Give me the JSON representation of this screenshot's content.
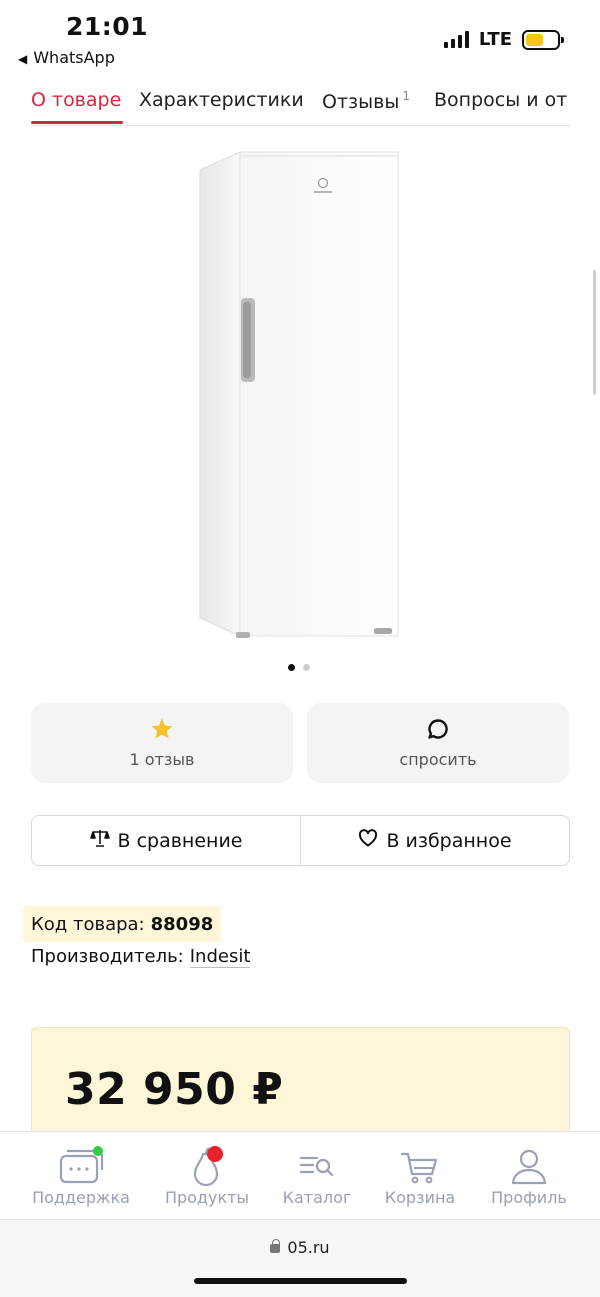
{
  "status_bar": {
    "time": "21:01",
    "back_app": "WhatsApp",
    "network": "LTE",
    "battery_level": 0.55,
    "battery_color": "#f5c518"
  },
  "tabs": [
    {
      "label": "О товаре",
      "active": true
    },
    {
      "label": "Характеристики",
      "active": false
    },
    {
      "label": "Отзывы",
      "count": "1",
      "active": false
    },
    {
      "label": "Вопросы и от",
      "active": false
    }
  ],
  "gallery": {
    "image_icon": "refrigerator-image",
    "brand_mark": "indesit",
    "page_index": 1,
    "page_count": 2
  },
  "cards": {
    "reviews_label": "1 отзыв",
    "reviews_icon": "star-icon",
    "ask_label": "спросить",
    "ask_icon": "chat-bubble-icon"
  },
  "actions": {
    "compare_label": "В сравнение",
    "favorite_label": "В избранное"
  },
  "info": {
    "code_label": "Код товара:",
    "code_value": "88098",
    "maker_label": "Производитель:",
    "maker_value": "Indesit"
  },
  "price": {
    "value": "32 950 ₽"
  },
  "bottom_nav": [
    {
      "label": "Поддержка",
      "icon": "chat-support-icon",
      "badge_color": "#2ecc40"
    },
    {
      "label": "Продукты",
      "icon": "pear-icon",
      "badge_color": "#e8232b"
    },
    {
      "label": "Каталог",
      "icon": "catalog-search-icon"
    },
    {
      "label": "Корзина",
      "icon": "cart-icon"
    },
    {
      "label": "Профиль",
      "icon": "user-icon"
    }
  ],
  "browser": {
    "url": "05.ru"
  },
  "colors": {
    "accent": "#d7263d",
    "nav_icon": "#9aa0b5",
    "price_bg": "#fdf6d8"
  }
}
